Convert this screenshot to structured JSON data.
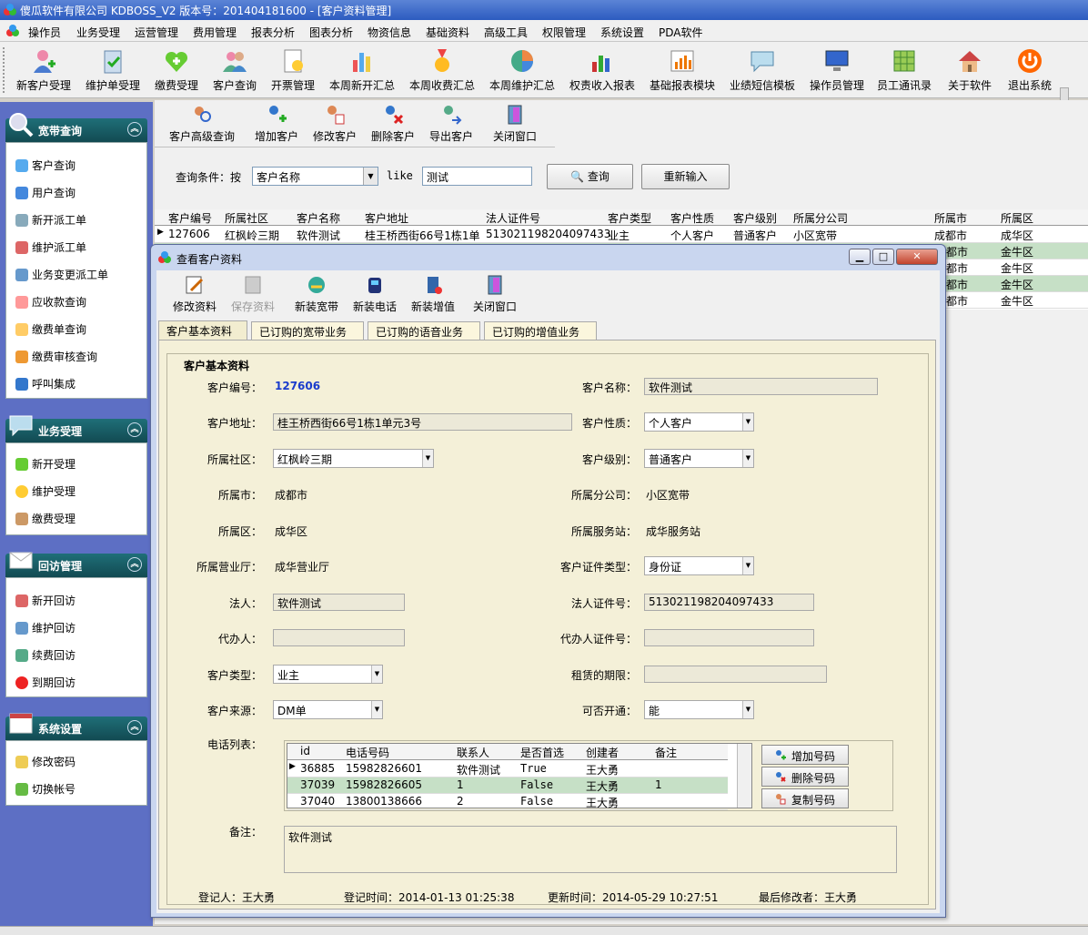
{
  "window": {
    "title": "傻瓜软件有限公司   KDBOSS_V2   版本号：201404181600 - [客户资料管理]"
  },
  "menu": [
    "操作员",
    "业务受理",
    "运营管理",
    "费用管理",
    "报表分析",
    "图表分析",
    "物资信息",
    "基础资料",
    "高级工具",
    "权限管理",
    "系统设置",
    "PDA软件"
  ],
  "toolbar": [
    "新客户受理",
    "维护单受理",
    "缴费受理",
    "客户查询",
    "开票管理",
    "本周新开汇总",
    "本周收费汇总",
    "本周维护汇总",
    "权责收入报表",
    "基础报表模块",
    "业绩短信模板",
    "操作员管理",
    "员工通讯录",
    "关于软件",
    "退出系统"
  ],
  "sidebar": {
    "sections": [
      {
        "title": "宽带查询",
        "items": [
          "客户查询",
          "用户查询",
          "新开派工单",
          "维护派工单",
          "业务变更派工单",
          "应收款查询",
          "缴费单查询",
          "缴费审核查询",
          "呼叫集成"
        ]
      },
      {
        "title": "业务受理",
        "items": [
          "新开受理",
          "维护受理",
          "缴费受理"
        ]
      },
      {
        "title": "回访管理",
        "items": [
          "新开回访",
          "维护回访",
          "续费回访",
          "到期回访"
        ]
      },
      {
        "title": "系统设置",
        "items": [
          "修改密码",
          "切换帐号"
        ]
      }
    ]
  },
  "main_toolbar": [
    "客户高级查询",
    "增加客户",
    "修改客户",
    "删除客户",
    "导出客户",
    "关闭窗口"
  ],
  "query": {
    "prefix": "查询条件：按",
    "field": "客户名称",
    "op": "like",
    "value": "测试",
    "search": "查询",
    "reset": "重新输入"
  },
  "grid": {
    "headers": [
      "客户编号",
      "所属社区",
      "客户名称",
      "客户地址",
      "法人证件号",
      "客户类型",
      "客户性质",
      "客户级别",
      "所属分公司",
      "所属市",
      "所属区"
    ],
    "row1": [
      "127606",
      "红枫岭三期",
      "软件测试",
      "桂王桥西街66号1栋1单",
      "513021198204097433",
      "业主",
      "个人客户",
      "普通客户",
      "小区宽带",
      "成都市",
      "成华区"
    ],
    "partial": [
      [
        "都市",
        "金牛区"
      ],
      [
        "都市",
        "金牛区"
      ],
      [
        "都市",
        "金牛区"
      ],
      [
        "都市",
        "金牛区"
      ]
    ]
  },
  "dialog": {
    "title": "查看客户资料",
    "toolbar": [
      "修改资料",
      "保存资料",
      "新装宽带",
      "新装电话",
      "新装增值",
      "关闭窗口"
    ],
    "tabs": [
      "客户基本资料",
      "已订购的宽带业务",
      "已订购的语音业务",
      "已订购的增值业务"
    ],
    "legend": "客户基本资料",
    "labels": {
      "cust_no": "客户编号：",
      "cust_name": "客户名称：",
      "address": "客户地址：",
      "nature": "客户性质：",
      "community": "所属社区：",
      "level": "客户级别：",
      "city": "所属市：",
      "branch": "所属分公司：",
      "district": "所属区：",
      "station": "所属服务站：",
      "hall": "所属营业厅：",
      "id_type": "客户证件类型：",
      "legal": "法人：",
      "legal_id": "法人证件号：",
      "agent": "代办人：",
      "agent_id": "代办人证件号：",
      "type": "客户类型：",
      "lease": "租赁的期限：",
      "source": "客户来源：",
      "open": "可否开通：",
      "phones": "电话列表：",
      "remark": "备注："
    },
    "values": {
      "cust_no": "127606",
      "cust_name": "软件测试",
      "address": "桂王桥西街66号1栋1单元3号",
      "nature": "个人客户",
      "community": "红枫岭三期",
      "level": "普通客户",
      "city": "成都市",
      "branch": "小区宽带",
      "district": "成华区",
      "station": "成华服务站",
      "hall": "成华营业厅",
      "id_type": "身份证",
      "legal": "软件测试",
      "legal_id": "513021198204097433",
      "agent": "",
      "agent_id": "",
      "type": "业主",
      "lease": "",
      "source": "DM单",
      "open": "能",
      "remark": "软件测试"
    },
    "phone_headers": [
      "id",
      "电话号码",
      "联系人",
      "是否首选",
      "创建者",
      "备注"
    ],
    "phone_rows": [
      [
        "36885",
        "15982826601",
        "软件测试",
        "True",
        "王大勇",
        ""
      ],
      [
        "37039",
        "15982826605",
        "1",
        "False",
        "王大勇",
        "1"
      ],
      [
        "37040",
        "13800138666",
        "2",
        "False",
        "王大勇",
        ""
      ]
    ],
    "phone_buttons": [
      "增加号码",
      "删除号码",
      "复制号码"
    ],
    "footer": {
      "registrar": "登记人：王大勇",
      "reg_time": "登记时间：2014-01-13 01:25:38",
      "upd_time": "更新时间：2014-05-29 10:27:51",
      "modifier": "最后修改者：王大勇"
    }
  },
  "colors": {
    "accent": "#1f6f78",
    "sidebar_bg": "#5d6fc4",
    "row_alt": "#c6e0c6",
    "panel": "#f4f0d8"
  }
}
